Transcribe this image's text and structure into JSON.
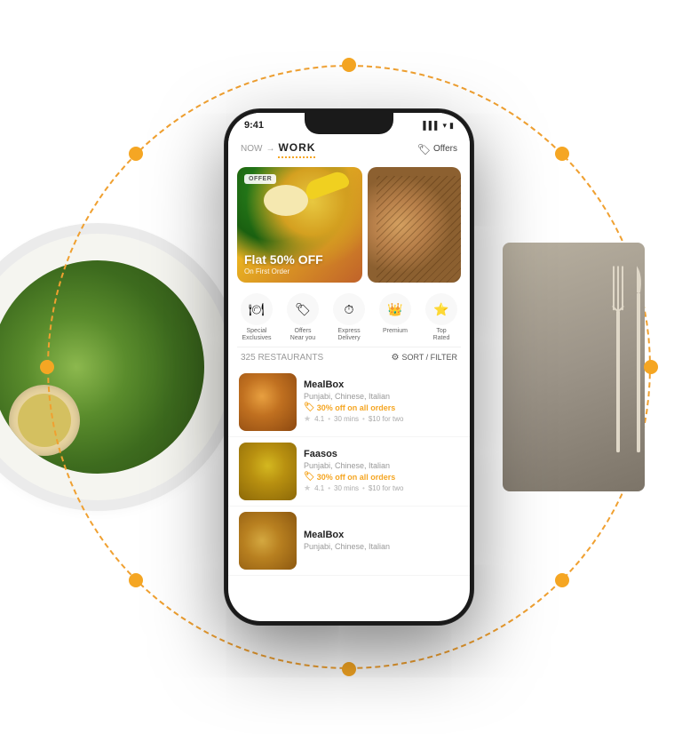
{
  "background": {
    "dashed_circle_color": "#f5a623"
  },
  "statusBar": {
    "time": "9:41",
    "signal": "▌▌▌",
    "wifi": "WiFi",
    "battery": "🔋"
  },
  "header": {
    "location_label": "NOW",
    "arrow": "→",
    "location_name": "WORK",
    "offers_label": "Offers",
    "offers_icon": "⊛"
  },
  "banner": {
    "badge": "OFFER",
    "title": "Flat 50% OFF",
    "subtitle": "On First Order"
  },
  "categories": [
    {
      "icon": "🍽",
      "label": "Special\nExclusives"
    },
    {
      "icon": "🏷",
      "label": "Offers\nNear you"
    },
    {
      "icon": "⏱",
      "label": "Express\nDelivery"
    },
    {
      "icon": "👑",
      "label": "Premium"
    },
    {
      "icon": "⭐",
      "label": "Top\nRated"
    }
  ],
  "listHeader": {
    "count": "325 RESTAURANTS",
    "sort_label": "SORT / FILTER",
    "filter_icon": "⚙"
  },
  "restaurants": [
    {
      "name": "MealBox",
      "cuisine": "Punjabi, Chinese, Italian",
      "offer": "30% off on all orders",
      "rating": "4.1",
      "time": "30 mins",
      "price": "$10 for two"
    },
    {
      "name": "Faasos",
      "cuisine": "Punjabi, Chinese, Italian",
      "offer": "30% off on all orders",
      "rating": "4.1",
      "time": "30 mins",
      "price": "$10 for two"
    },
    {
      "name": "MealBox",
      "cuisine": "Punjabi, Chinese, Italian",
      "offer": "",
      "rating": "",
      "time": "",
      "price": ""
    }
  ]
}
